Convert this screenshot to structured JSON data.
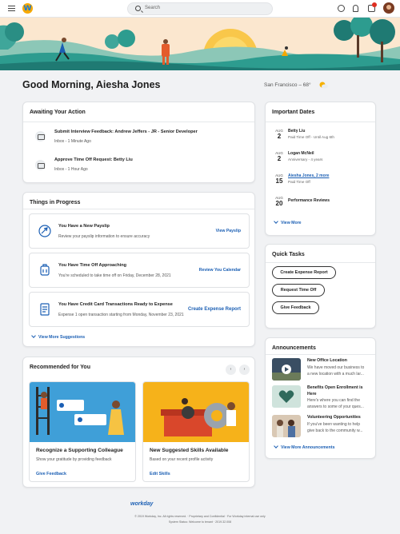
{
  "topbar": {
    "search_placeholder": "Search"
  },
  "greeting": "Good Morning, Aiesha Jones",
  "weather": "San Francisco – 68°",
  "awaiting": {
    "title": "Awaiting Your Action",
    "items": [
      {
        "title": "Submit Interview Feedback: Andrew Jeffers - JR - Senior Developer",
        "sub": "Inbox - 1 Minute Ago"
      },
      {
        "title": "Approve Time Off Request: Betty Liu",
        "sub": "Inbox - 1 Hour Ago"
      }
    ]
  },
  "things": {
    "title": "Things in Progress",
    "items": [
      {
        "title": "You Have a New Payslip",
        "desc": "Review your payslip information to ensure accuracy",
        "action": "View Payslip"
      },
      {
        "title": "You Have Time Off Approaching",
        "desc": "You're scheduled to take time off on Friday, December 28, 2021",
        "action": "Review You Calendar"
      },
      {
        "title": "You Have Credit Card Transactions Ready to Expense",
        "desc": "Expense 1 open transaction starting from Monday, November 23, 2021",
        "action": "Create Expense Report"
      }
    ],
    "more": "View More Suggestions"
  },
  "recommended": {
    "title": "Recommended for You",
    "prev": "‹",
    "next": "›",
    "items": [
      {
        "title": "Recognize a Supporting Colleague",
        "desc": "Show your gratitude by providing feedback",
        "link": "Give Feedback"
      },
      {
        "title": "New Suggested Skills Available",
        "desc": "Based on your recent profile activity",
        "link": "Edit Skills"
      }
    ]
  },
  "dates": {
    "title": "Important Dates",
    "items": [
      {
        "month": "AUG",
        "day": "2",
        "title": "Betty Liu",
        "sub": "Paid Time Off - Until Aug 6th"
      },
      {
        "month": "AUG",
        "day": "2",
        "title": "Logan McNeil",
        "sub": "Anniversary - 4 years"
      },
      {
        "month": "AUG",
        "day": "15",
        "title": "Aiesha Jones, 2 more",
        "sub": "Paid Time Off"
      },
      {
        "month": "AUG",
        "day": "20",
        "title": "Performance Reviews",
        "sub": ""
      }
    ],
    "more": "View More"
  },
  "quick_tasks": {
    "title": "Quick Tasks",
    "buttons": [
      "Create Expense Report",
      "Request Time Off",
      "Give Feedback"
    ]
  },
  "announcements": {
    "title": "Announcements",
    "items": [
      {
        "title": "New Office Location",
        "desc1": "We have moved our business to",
        "desc2": "a new location with a much lar..."
      },
      {
        "title": "Benefits Open Enrollment is",
        "title2": "Here",
        "desc1": "Here's where you can find the",
        "desc2": "answers to some of your ques..."
      },
      {
        "title": "Volunteering Opportunities",
        "desc1": "If you've been wanting to help",
        "desc2": "give back to the community w..."
      }
    ],
    "more": "View More Announcements"
  },
  "footer": {
    "logo": "workday",
    "line1": "© 2019 Workday, Inc. All rights reserved. · Proprietary and Confidential · For Workday internal use only",
    "line2": "System Status: Welcome to tenant · 2019.32.008"
  },
  "colors": {
    "accent": "#1b5fb4",
    "badge": "#de2e21",
    "brand_orange": "#f6a800"
  }
}
